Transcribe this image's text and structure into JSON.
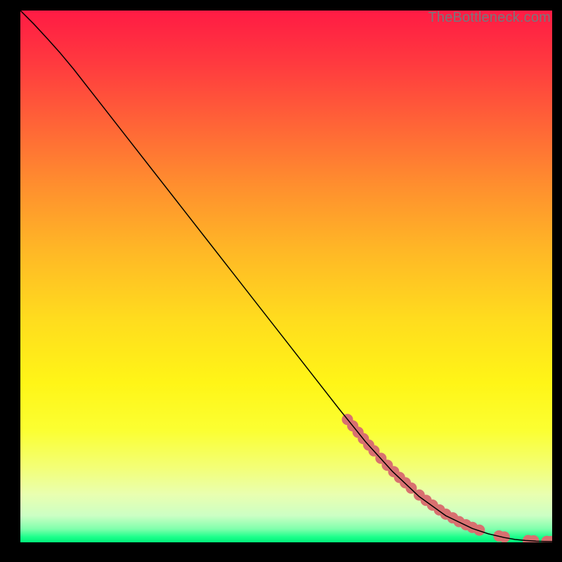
{
  "watermark": "TheBottleneck.com",
  "chart_data": {
    "type": "line",
    "title": "",
    "xlabel": "",
    "ylabel": "",
    "xlim": [
      0,
      100
    ],
    "ylim": [
      0,
      100
    ],
    "grid": false,
    "series": [
      {
        "name": "curve",
        "style": "line",
        "color": "#000000",
        "x": [
          0.0,
          2.5,
          5.0,
          7.5,
          10.0,
          15.0,
          20.0,
          25.0,
          30.0,
          35.0,
          40.0,
          45.0,
          50.0,
          55.0,
          60.0,
          65.0,
          70.0,
          75.0,
          80.0,
          85.0,
          88.0,
          91.0,
          93.0,
          95.0,
          97.0,
          98.5,
          100.0
        ],
        "y": [
          100.0,
          97.5,
          94.8,
          92.0,
          89.0,
          82.6,
          76.2,
          69.8,
          63.4,
          57.0,
          50.6,
          44.2,
          37.8,
          31.4,
          25.0,
          18.8,
          13.3,
          8.6,
          5.0,
          2.6,
          1.6,
          0.9,
          0.55,
          0.35,
          0.22,
          0.17,
          0.15
        ]
      },
      {
        "name": "highlight-points",
        "style": "markers",
        "color": "#d87070",
        "radius": 8,
        "x": [
          61.5,
          62.5,
          63.5,
          64.5,
          65.5,
          66.5,
          67.8,
          69.0,
          70.2,
          71.3,
          72.4,
          73.5,
          75.0,
          76.3,
          77.5,
          78.8,
          80.0,
          81.3,
          82.5,
          83.8,
          85.0,
          86.3,
          90.0,
          91.0,
          95.5,
          96.5,
          99.0,
          99.8
        ],
        "y": [
          23.1,
          21.9,
          20.7,
          19.5,
          18.3,
          17.2,
          15.8,
          14.5,
          13.3,
          12.2,
          11.2,
          10.2,
          8.9,
          7.9,
          7.0,
          6.1,
          5.3,
          4.6,
          3.9,
          3.3,
          2.8,
          2.3,
          1.2,
          1.0,
          0.35,
          0.3,
          0.18,
          0.16
        ]
      }
    ]
  }
}
